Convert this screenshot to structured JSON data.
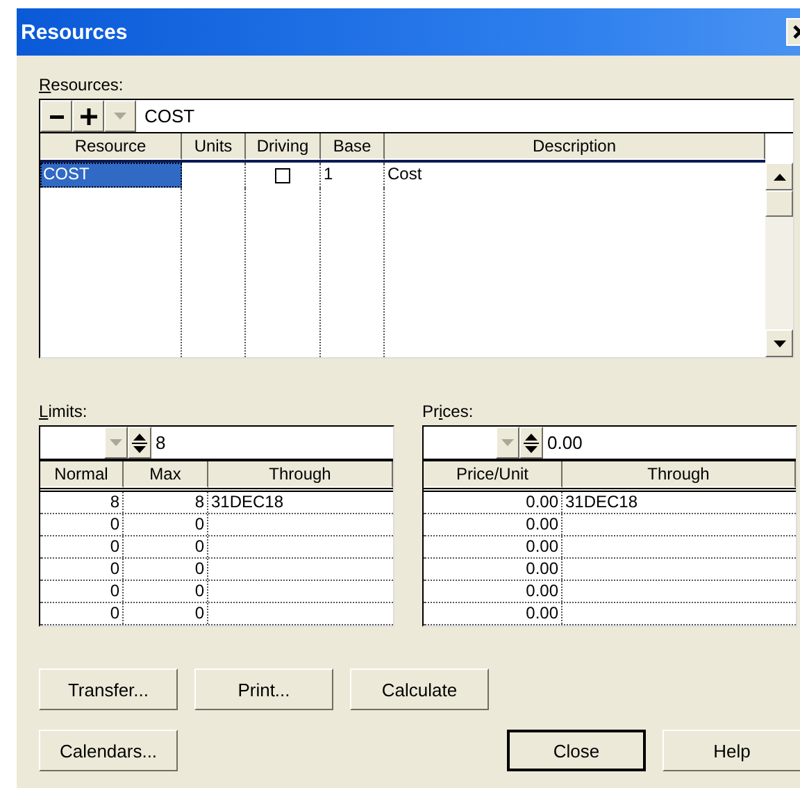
{
  "window": {
    "title": "Resources"
  },
  "resources": {
    "label": "Resources:",
    "value": "COST",
    "columns": [
      "Resource",
      "Units",
      "Driving",
      "Base",
      "Description"
    ],
    "rows": [
      {
        "resource": "COST",
        "driving": false,
        "base": "1",
        "description": "Cost",
        "selected": true
      }
    ]
  },
  "limits": {
    "label": "Limits:",
    "value": "8",
    "columns": [
      "Normal",
      "Max",
      "Through"
    ],
    "rows": [
      {
        "normal": "8",
        "max": "8",
        "through": "31DEC18"
      },
      {
        "normal": "0",
        "max": "0"
      },
      {
        "normal": "0",
        "max": "0"
      },
      {
        "normal": "0",
        "max": "0"
      },
      {
        "normal": "0",
        "max": "0"
      },
      {
        "normal": "0",
        "max": "0"
      }
    ]
  },
  "prices": {
    "label": "Prices:",
    "value": "0.00",
    "columns": [
      "Price/Unit",
      "Through"
    ],
    "rows": [
      {
        "price_unit": "0.00",
        "through": "31DEC18"
      },
      {
        "price_unit": "0.00"
      },
      {
        "price_unit": "0.00"
      },
      {
        "price_unit": "0.00"
      },
      {
        "price_unit": "0.00"
      },
      {
        "price_unit": "0.00"
      }
    ]
  },
  "buttons": [
    {
      "label": "Transfer...",
      "default": false
    },
    {
      "label": "Print...",
      "default": false
    },
    {
      "label": "Calculate",
      "default": false
    }
  ],
  "bottom_buttons": [
    {
      "label": "Calendars...",
      "default": false
    },
    {
      "label": "Close",
      "default": true
    },
    {
      "label": "Help",
      "default": false
    }
  ]
}
